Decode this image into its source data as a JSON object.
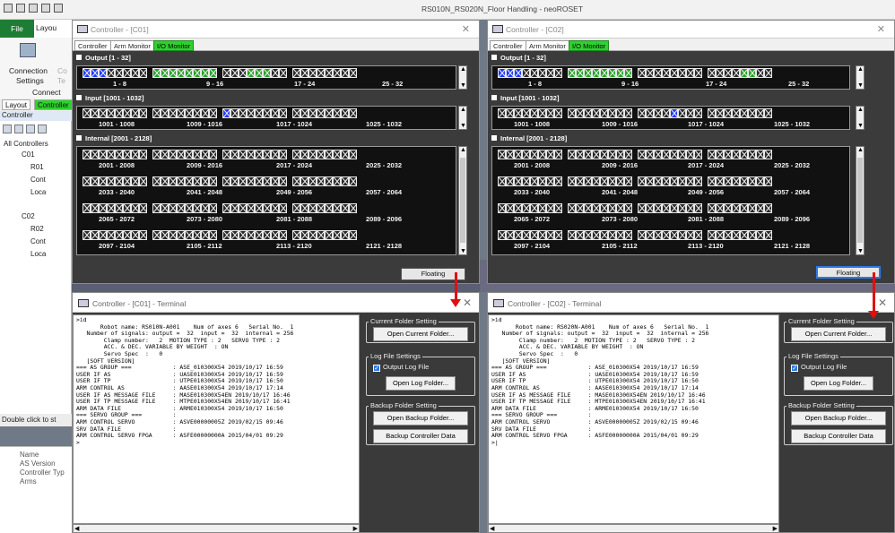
{
  "app": {
    "title": "RS010N_RS020N_Floor Handling - neoROSET",
    "file_menu": "File",
    "layout_menu": "Layou",
    "ribbon": {
      "connection": "Connection",
      "settings": "Settings",
      "connect": "Connect",
      "c1": "Co",
      "c2": "Te"
    },
    "left_tabs": [
      "Layout",
      "Controller"
    ],
    "tree_header": "Controller",
    "tree": [
      "All Controllers",
      "C01",
      "R01",
      "Cont",
      "Loca",
      "C02",
      "R02",
      "Cont",
      "Loca"
    ],
    "double_click": "Double click to st",
    "props": [
      "Name",
      "AS Version",
      "Controller Typ",
      "Arms"
    ]
  },
  "controllers": [
    {
      "title": "Controller - [C01]",
      "tabs": [
        "Controller",
        "Arm Monitor",
        "I/O Monitor"
      ],
      "active_tab": "I/O Monitor",
      "output": {
        "label": "Output [1 - 32]",
        "ranges": [
          "1 - 8",
          "9 - 16",
          "17 - 24",
          "25 - 32"
        ],
        "on_blue": [
          0,
          1,
          2
        ],
        "on_green": [
          8,
          9,
          10,
          11,
          12,
          13,
          14,
          15,
          19,
          20,
          21
        ]
      },
      "input": {
        "label": "Input [1001 - 1032]",
        "ranges": [
          "1001 - 1008",
          "1009 - 1016",
          "1017 - 1024",
          "1025 - 1032"
        ],
        "on_blue": [
          16
        ]
      },
      "internal": {
        "label": "Internal [2001 - 2128]",
        "rows": [
          [
            "2001 - 2008",
            "2009 - 2016",
            "2017 - 2024",
            "2025 - 2032"
          ],
          [
            "2033 - 2040",
            "2041 - 2048",
            "2049 - 2056",
            "2057 - 2064"
          ],
          [
            "2065 - 2072",
            "2073 - 2080",
            "2081 - 2088",
            "2089 - 2096"
          ],
          [
            "2097 - 2104",
            "2105 - 2112",
            "2113 - 2120",
            "2121 - 2128"
          ]
        ]
      },
      "floating_label": "Floating"
    },
    {
      "title": "Controller - [C02]",
      "tabs": [
        "Controller",
        "Arm Monitor",
        "I/O Monitor"
      ],
      "active_tab": "I/O Monitor",
      "output": {
        "label": "Output [1 - 32]",
        "ranges": [
          "1 - 8",
          "9 - 16",
          "17 - 24",
          "25 - 32"
        ],
        "on_blue": [
          0,
          1,
          2
        ],
        "on_green": [
          8,
          9,
          10,
          11,
          12,
          13,
          14,
          15,
          28,
          29
        ]
      },
      "input": {
        "label": "Input [1001 - 1032]",
        "ranges": [
          "1001 - 1008",
          "1009 - 1016",
          "1017 - 1024",
          "1025 - 1032"
        ],
        "on_blue": [
          20
        ]
      },
      "internal": {
        "label": "Internal [2001 - 2128]",
        "rows": [
          [
            "2001 - 2008",
            "2009 - 2016",
            "2017 - 2024",
            "2025 - 2032"
          ],
          [
            "2033 - 2040",
            "2041 - 2048",
            "2049 - 2056",
            "2057 - 2064"
          ],
          [
            "2065 - 2072",
            "2073 - 2080",
            "2081 - 2088",
            "2089 - 2096"
          ],
          [
            "2097 - 2104",
            "2105 - 2112",
            "2113 - 2120",
            "2121 - 2128"
          ]
        ]
      },
      "floating_label": "Floating"
    }
  ],
  "terminals": [
    {
      "title": "Controller - [C01] - Terminal",
      "lines": [
        ">id",
        "       Robot name: RS010N-A001    Num of axes 6   Serial No.  1",
        "   Number of signals: output =  32  input =  32  internal = 256",
        "        Clamp number:   2  MOTION TYPE : 2   SERVO TYPE : 2",
        "        ACC. & DEC. VARIABLE BY WEIGHT  : ON",
        "        Servo Spec  :   0",
        "   [SOFT VERSION]",
        "=== AS GROUP ===            : ASE_010300X54 2019/10/17 16:59",
        "USER IF AS                  : UASE010300X54 2019/10/17 16:59",
        "USER IF TP                  : UTPE010300X54 2019/10/17 16:50",
        "ARM CONTROL AS              : AASE010300X54 2019/10/17 17:14",
        "USER IF AS MESSAGE FILE     : MASE010300X54EN 2019/10/17 16:46",
        "USER IF TP MESSAGE FILE     : MTPE010300X54EN 2019/10/17 16:41",
        "ARM DATA FILE               : ARME010300X54 2019/10/17 16:50",
        "=== SERVO GROUP ===         :",
        "ARM CONTROL SERVO           : ASVE00000005Z 2019/02/15 09:46",
        "SRV DATA FILE               :",
        "ARM CONTROL SERVO FPGA      : ASFE00000000A 2015/04/01 09:29",
        ">"
      ],
      "current_folder": {
        "legend": "Current Folder Setting",
        "button": "Open Current Folder..."
      },
      "log_file": {
        "legend": "Log File Settings",
        "checkbox": "Output Log File",
        "button": "Open Log Folder..."
      },
      "backup": {
        "legend": "Backup Folder Setting",
        "open_button": "Open Backup Folder...",
        "backup_button": "Backup Controller Data"
      }
    },
    {
      "title": "Controller - [C02] - Terminal",
      "lines": [
        ">id",
        "       Robot name: RS020N-A001    Num of axes 6   Serial No.  1",
        "   Number of signals: output =  32  input =  32  internal = 256",
        "        Clamp number:   2  MOTION TYPE : 2   SERVO TYPE : 2",
        "        ACC. & DEC. VARIABLE BY WEIGHT  : ON",
        "        Servo Spec  :   0",
        "   [SOFT VERSION]",
        "=== AS GROUP ===            : ASE_010300X54 2019/10/17 16:59",
        "USER IF AS                  : UASE010300X54 2019/10/17 16:59",
        "USER IF TP                  : UTPE010300X54 2019/10/17 16:50",
        "ARM CONTROL AS              : AASE010300X54 2019/10/17 17:14",
        "USER IF AS MESSAGE FILE     : MASE010300X54EN 2019/10/17 16:46",
        "USER IF TP MESSAGE FILE     : MTPE010300X54EN 2019/10/17 16:41",
        "ARM DATA FILE               : ARME010300X54 2019/10/17 16:50",
        "=== SERVO GROUP ===         :",
        "ARM CONTROL SERVO           : ASVE00000005Z 2019/02/15 09:46",
        "SRV DATA FILE               :",
        "ARM CONTROL SERVO FPGA      : ASFE00000000A 2015/04/01 09:29",
        ">|"
      ],
      "current_folder": {
        "legend": "Current Folder Setting",
        "button": "Open Current Folder..."
      },
      "log_file": {
        "legend": "Log File Settings",
        "checkbox": "Output Log File",
        "button": "Open Log Folder..."
      },
      "backup": {
        "legend": "Backup Folder Setting",
        "open_button": "Open Backup Folder...",
        "backup_button": "Backup Controller Data"
      }
    }
  ],
  "colors": {
    "active_tab": "#2fd02f",
    "signal_on": "#1f3cff",
    "signal_green": "#2aa12a",
    "arrow": "#e01010"
  }
}
